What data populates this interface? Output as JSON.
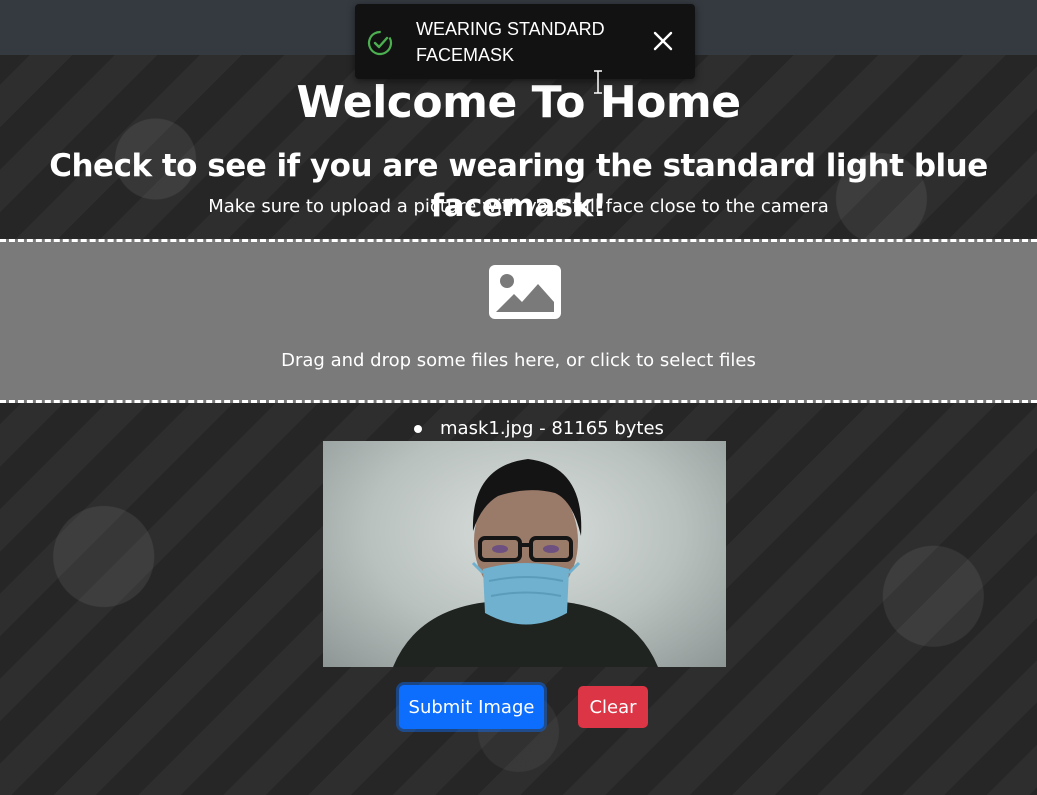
{
  "toast": {
    "message": "WEARING STANDARD FACEMASK",
    "icon": "check-circle-icon",
    "close_icon": "close-icon",
    "accent_color": "#4caf50"
  },
  "header": {
    "title": "Welcome To Home",
    "subtitle": "Check to see if you are wearing the standard light blue facemask!",
    "instruction": "Make sure to upload a picture with your full face close to the camera"
  },
  "dropzone": {
    "icon": "image-icon",
    "hint": "Drag and drop some files here, or click to select files"
  },
  "files": [
    {
      "label": "mask1.jpg - 81165 bytes"
    }
  ],
  "actions": {
    "submit_label": "Submit Image",
    "clear_label": "Clear",
    "submit_color": "#0d6efd",
    "clear_color": "#dc3545"
  }
}
